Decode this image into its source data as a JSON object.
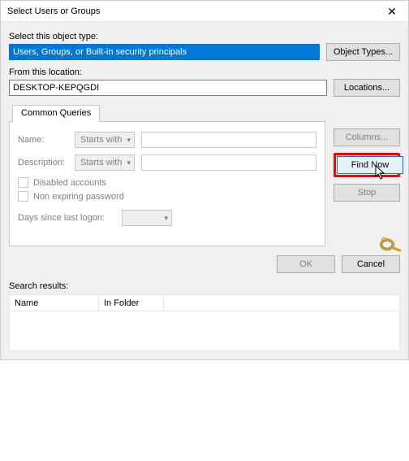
{
  "window": {
    "title": "Select Users or Groups"
  },
  "objectType": {
    "label": "Select this object type:",
    "value": "Users, Groups, or Built-in security principals",
    "button": "Object Types..."
  },
  "location": {
    "label": "From this location:",
    "value": "DESKTOP-KEPQGDI",
    "button": "Locations..."
  },
  "tab": {
    "label": "Common Queries"
  },
  "queries": {
    "name_label": "Name:",
    "name_mode": "Starts with",
    "desc_label": "Description:",
    "desc_mode": "Starts with",
    "disabled_accounts": "Disabled accounts",
    "non_expiring": "Non expiring password",
    "days_label": "Days since last logon:"
  },
  "side": {
    "columns": "Columns...",
    "find_now": "Find Now",
    "stop": "Stop"
  },
  "footer": {
    "ok": "OK",
    "cancel": "Cancel"
  },
  "results": {
    "label": "Search results:",
    "col_name": "Name",
    "col_folder": "In Folder"
  }
}
